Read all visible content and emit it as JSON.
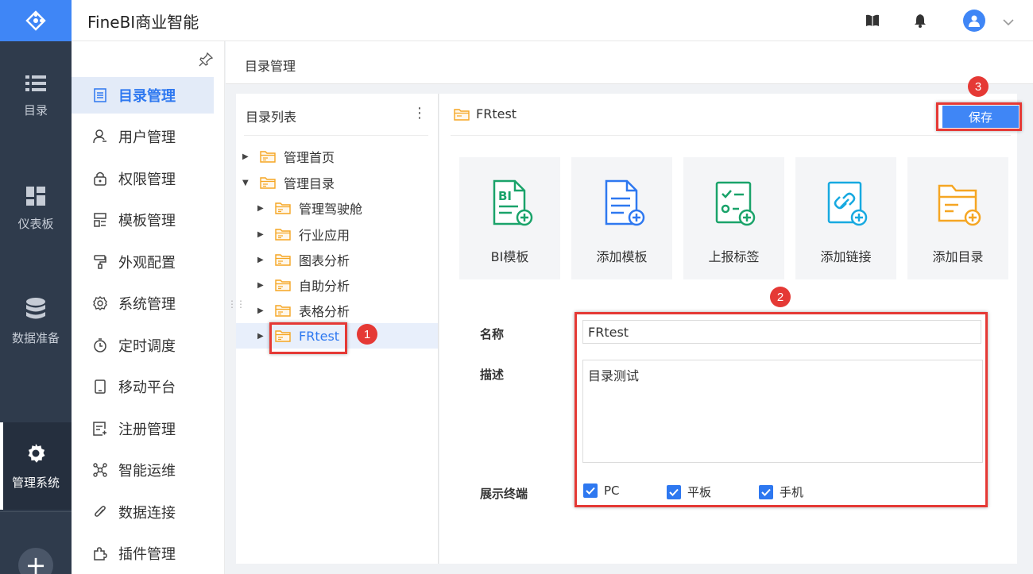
{
  "app": {
    "title": "FineBI商业智能"
  },
  "rail": {
    "items": [
      {
        "label": "目录",
        "icon": "list-icon"
      },
      {
        "label": "仪表板",
        "icon": "dashboard-icon"
      },
      {
        "label": "数据准备",
        "icon": "database-icon"
      },
      {
        "label": "管理系统",
        "icon": "gear-icon",
        "active": true
      }
    ],
    "add_label": "+"
  },
  "nav": {
    "items": [
      {
        "label": "目录管理",
        "icon": "catalog-icon",
        "active": true
      },
      {
        "label": "用户管理",
        "icon": "user-icon"
      },
      {
        "label": "权限管理",
        "icon": "lock-icon"
      },
      {
        "label": "模板管理",
        "icon": "template-icon"
      },
      {
        "label": "外观配置",
        "icon": "paint-roller-icon"
      },
      {
        "label": "系统管理",
        "icon": "settings-icon"
      },
      {
        "label": "定时调度",
        "icon": "stopwatch-icon"
      },
      {
        "label": "移动平台",
        "icon": "mobile-icon"
      },
      {
        "label": "注册管理",
        "icon": "register-icon"
      },
      {
        "label": "智能运维",
        "icon": "network-icon"
      },
      {
        "label": "数据连接",
        "icon": "paperclip-icon"
      },
      {
        "label": "插件管理",
        "icon": "puzzle-icon"
      }
    ]
  },
  "breadcrumb": {
    "label": "目录管理"
  },
  "tree": {
    "header": "目录列表",
    "more": "⋮",
    "nodes": [
      {
        "label": "管理首页",
        "expanded": false
      },
      {
        "label": "管理目录",
        "expanded": true
      },
      {
        "label": "管理驾驶舱"
      },
      {
        "label": "行业应用"
      },
      {
        "label": "图表分析"
      },
      {
        "label": "自助分析"
      },
      {
        "label": "表格分析"
      },
      {
        "label": "FRtest",
        "selected": true
      }
    ]
  },
  "detail": {
    "title": "FRtest",
    "save_label": "保存",
    "cards": [
      {
        "label": "BI模板",
        "icon": "bi-template-icon",
        "color": "#1aa36a"
      },
      {
        "label": "添加模板",
        "icon": "add-template-icon",
        "color": "#2e78f0"
      },
      {
        "label": "上报标签",
        "icon": "report-tag-icon",
        "color": "#1aa36a"
      },
      {
        "label": "添加链接",
        "icon": "add-link-icon",
        "color": "#17a9e0"
      },
      {
        "label": "添加目录",
        "icon": "add-folder-icon",
        "color": "#f5a623"
      }
    ],
    "form": {
      "name_label": "名称",
      "name_value": "FRtest",
      "desc_label": "描述",
      "desc_value": "目录测试",
      "terminal_label": "展示终端",
      "terminals": [
        {
          "label": "PC",
          "checked": true
        },
        {
          "label": "平板",
          "checked": true
        },
        {
          "label": "手机",
          "checked": true
        }
      ]
    }
  },
  "annotations": {
    "step1": "1",
    "step2": "2",
    "step3": "3"
  },
  "colors": {
    "accent": "#3f86f6",
    "rail": "#2f3b4c",
    "highlight": "#e53935",
    "folder": "#f5a623"
  }
}
